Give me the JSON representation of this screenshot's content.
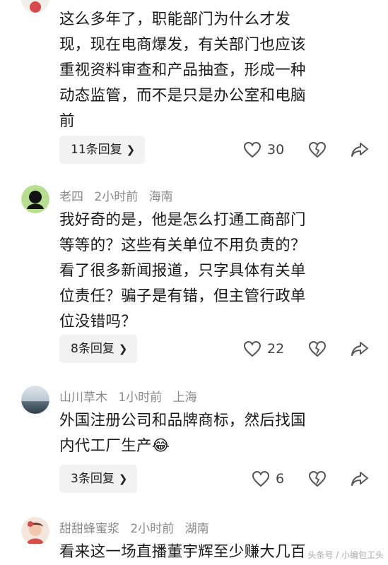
{
  "comments": [
    {
      "text_lines": [
        "这么多年了，职能部门为什么才发",
        "现，现在电商爆发，有关部门也应该",
        "重视资料审查和产品抽查，形成一种",
        "动态监管，而不是只是办公室和电脑",
        "前"
      ],
      "reply_label": "11条回复",
      "likes": "30"
    },
    {
      "username": "老四",
      "time": "2小时前",
      "location": "海南",
      "text_lines": [
        "我好奇的是，他是怎么打通工商部门",
        "等等的？这些有关单位不用负责的？",
        "看了很多新闻报道，只字具体有关单",
        "位责任？骗子是有错，但主管行政单",
        "位没错吗？"
      ],
      "reply_label": "8条回复",
      "likes": "22"
    },
    {
      "username": "山川草木",
      "time": "1小时前",
      "location": "上海",
      "text_lines": [
        "外国注册公司和品牌商标，然后找国",
        "内代工厂生产😂"
      ],
      "reply_label": "3条回复",
      "likes": "6"
    },
    {
      "username": "甜甜蜂蜜浆",
      "time": "2小时前",
      "location": "湖南",
      "text_lines": [
        "看来这一场直播董宇辉至少赚大几百"
      ]
    }
  ],
  "watermark": "头条号 / 小编包工头",
  "colors": {
    "meta": "#8a8a8a",
    "reply_bg": "#f2f2f2",
    "text": "#1a1a1a"
  }
}
